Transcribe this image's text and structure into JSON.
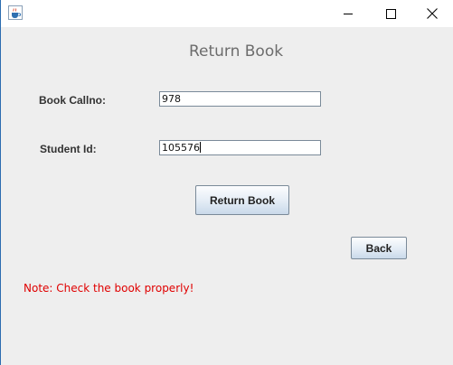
{
  "titlebar": {
    "icon": "java-cup-icon",
    "controls": [
      "minimize-icon",
      "maximize-icon",
      "close-icon"
    ]
  },
  "form": {
    "heading": "Return Book",
    "callno_label": "Book Callno:",
    "callno_value": "978",
    "studentid_label": "Student Id:",
    "studentid_value": "105576",
    "return_button": "Return Book",
    "back_button": "Back",
    "note": "Note: Check the book properly!"
  },
  "colors": {
    "background": "#eeeeee",
    "note": "#e00000",
    "heading": "#6c6c6c"
  }
}
